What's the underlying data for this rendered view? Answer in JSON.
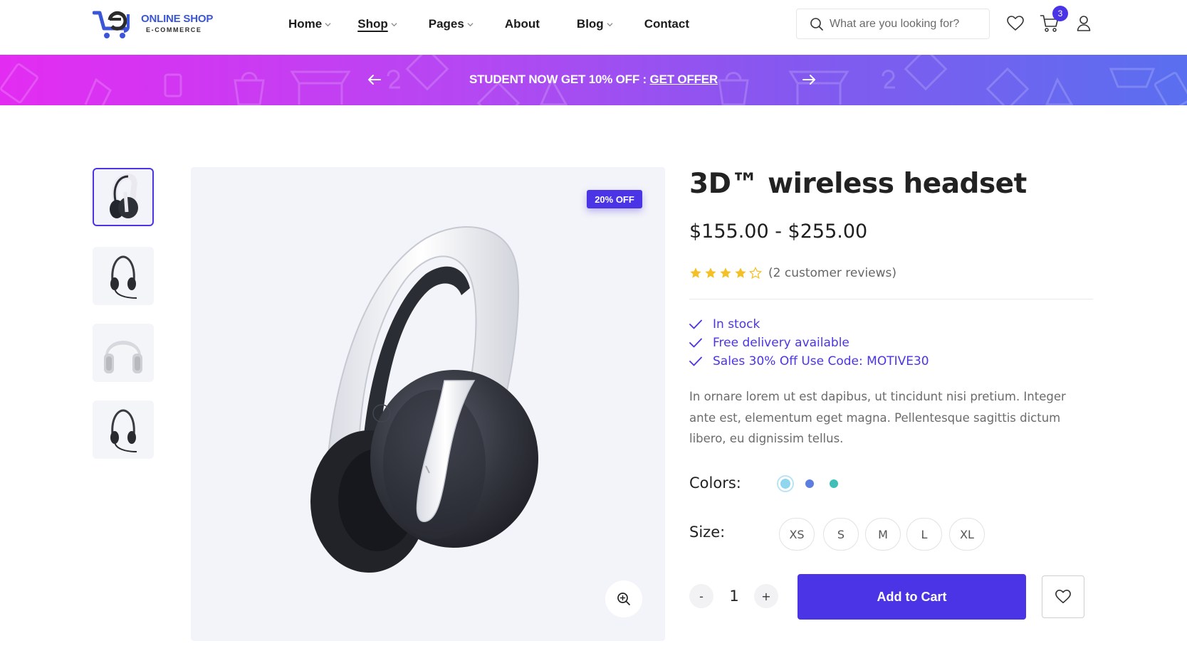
{
  "header": {
    "logo": {
      "line1": "ONLINE SHOP",
      "line2": "E-COMMERCE"
    },
    "nav": [
      {
        "label": "Home",
        "has_dropdown": true,
        "active": false
      },
      {
        "label": "Shop",
        "has_dropdown": true,
        "active": true
      },
      {
        "label": "Pages",
        "has_dropdown": true,
        "active": false
      },
      {
        "label": "About",
        "has_dropdown": false,
        "active": false
      },
      {
        "label": "Blog",
        "has_dropdown": true,
        "active": false
      },
      {
        "label": "Contact",
        "has_dropdown": false,
        "active": false
      }
    ],
    "search": {
      "placeholder": "What are you looking for?",
      "icon": "search-icon"
    },
    "icons": {
      "wishlist": "heart-icon",
      "cart": "cart-icon",
      "account": "user-icon"
    },
    "cart_count": "3"
  },
  "promo": {
    "text": "STUDENT NOW GET 10% OFF : ",
    "link": "GET OFFER",
    "prev_icon": "arrow-left-icon",
    "next_icon": "arrow-right-icon"
  },
  "gallery": {
    "thumbnails": [
      {
        "name": "thumb-headset-white",
        "active": true
      },
      {
        "name": "thumb-headset-mic",
        "active": false
      },
      {
        "name": "thumb-headphones-silver",
        "active": false
      },
      {
        "name": "thumb-headset-mic",
        "active": false
      }
    ],
    "badge": "20% OFF",
    "zoom_icon": "zoom-in-icon"
  },
  "product": {
    "title": "3D™ wireless headset",
    "price": "$155.00 - $255.00",
    "rating": 4,
    "rating_max": 5,
    "reviews": "(2 customer reviews)",
    "features": [
      "In stock",
      "Free delivery available",
      "Sales 30% Off Use Code: MOTIVE30"
    ],
    "description": "In ornare lorem ut est dapibus, ut tincidunt nisi pretium. Integer ante est, elementum eget magna. Pellentesque sagittis dictum libero, eu dignissim tellus.",
    "colors_label": "Colors:",
    "colors": [
      "#8fd6ee",
      "#5b7ee0",
      "#3fbfb7"
    ],
    "selected_color": 0,
    "size_label": "Size:",
    "sizes": [
      "XS",
      "S",
      "M",
      "L",
      "XL"
    ],
    "quantity": "1",
    "qty_minus": "-",
    "qty_plus": "+",
    "add_to_cart": "Add to Cart"
  },
  "colors": {
    "accent": "#4a34e6",
    "star": "#f5c026"
  }
}
